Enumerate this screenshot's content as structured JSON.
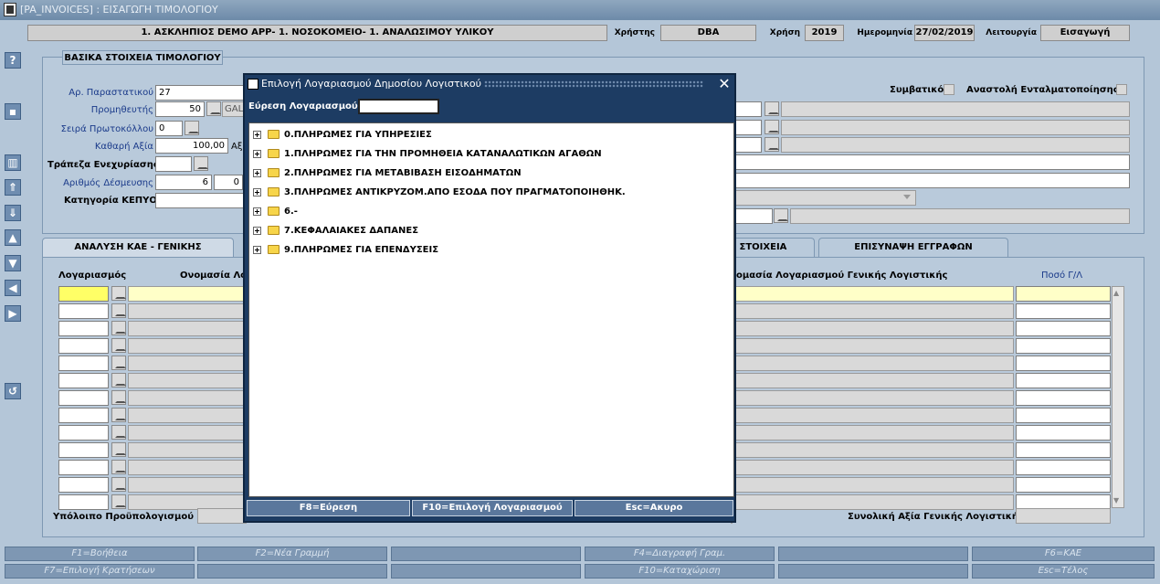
{
  "window": {
    "title": "[PA_INVOICES] : ΕΙΣΑΓΩΓΗ ΤΙΜΟΛΟΓΙΟΥ"
  },
  "header": {
    "org": "1. ΑΣΚΛΗΠΙΟΣ DEMO APP- 1. ΝΟΣΟΚΟΜΕΙΟ- 1. ΑΝΑΛΩΣΙΜΟΥ ΥΛΙΚΟΥ",
    "user_label": "Χρήστης",
    "user": "DBA",
    "year_label": "Χρήση",
    "year": "2019",
    "date_label": "Ημερομηνία",
    "date": "27/02/2019",
    "mode_label": "Λειτουργία",
    "mode": "Εισαγωγή"
  },
  "toolbar": {
    "icons": [
      "help-icon",
      "save-icon",
      "delete-icon",
      "first-record-icon",
      "last-record-icon",
      "prev-record-icon",
      "next-record-icon",
      "back-icon",
      "forward-icon",
      "undo-icon"
    ]
  },
  "basic": {
    "section_title": "ΒΑΣΙΚΑ ΣΤΟΙΧΕΙΑ ΤΙΜΟΛΟΓΙΟΥ",
    "doc_no_label": "Αρ. Παραστατικού",
    "doc_no": "27",
    "supplier_label": "Προμηθευτής",
    "supplier": "50",
    "supplier_name": "GAL",
    "protocol_label": "Σειρά Πρωτοκόλλου",
    "protocol": "0",
    "net_label": "Καθαρή Αξία",
    "net": "100,00",
    "net_suffix": "Αξ",
    "bank_label": "Τράπεζα Ενεχυρίασης",
    "commit_label": "Αριθμός Δέσμευσης",
    "commit_a": "6",
    "commit_b": "0",
    "kepyo_label": "Κατηγορία ΚΕΠΥΟ",
    "contract_label": "Συμβατικό",
    "suspend_label": "Αναστολή Ενταλματοποίησης"
  },
  "tabs": [
    "ΑΝΑΛΥΣΗ ΚΑΕ - ΓΕΝΙΚΗΣ ΛΟΓΙΣΤΙΚΗΣ",
    "ΚΑ ΣΤΟΙΧΕΙΑ",
    "ΕΠΙΣΥΝΑΨΗ ΕΓΓΡΑΦΩΝ"
  ],
  "grid": {
    "col_account": "Λογαριασμός",
    "col_name": "Ονομασία Λο",
    "col_gl_name": "ομασία Λογαριασμού Γενικής Λογιστικής",
    "col_amount": "Ποσό Γ/Λ"
  },
  "footer": {
    "budget_label": "Υπόλοιπο Προϋπολογισμού",
    "total_label": "Συνολική Αξία Γενικής Λογιστικής"
  },
  "fkeys": [
    [
      "F1=Βοήθεια",
      "F2=Νέα Γραμμή",
      "",
      "F4=Διαγραφή Γραμ.",
      "",
      "F6=ΚΑΕ"
    ],
    [
      "F7=Επιλογή Κρατήσεων",
      "",
      "",
      "F10=Καταχώριση",
      "",
      "Esc=Τέλος"
    ]
  ],
  "dialog": {
    "title": "Επιλογή Λογαριασμού Δημοσίου Λογιστικού",
    "search_label": "Εύρεση Λογαριασμού",
    "search_value": "",
    "nodes": [
      "0.ΠΛΗΡΩΜΕΣ ΓΙΑ ΥΠΗΡΕΣΙΕΣ",
      "1.ΠΛΗΡΩΜΕΣ ΓΙΑ ΤΗΝ ΠΡΟΜΗΘΕΙΑ ΚΑΤΑΝΑΛΩΤΙΚΩΝ ΑΓΑΘΩΝ",
      "2.ΠΛΗΡΩΜΕΣ ΓΙΑ ΜΕΤΑΒΙΒΑΣΗ ΕΙΣΟΔΗΜΑΤΩΝ",
      "3.ΠΛΗΡΩΜΕΣ ΑΝΤΙΚΡΥΖΟΜ.ΑΠΟ ΕΣΟΔΑ ΠΟΥ ΠΡΑΓΜΑΤΟΠΟΙΗΘΗΚ.",
      "6.-",
      "7.ΚΕΦΑΛΑΙΑΚΕΣ ΔΑΠΑΝΕΣ",
      "9.ΠΛΗΡΩΜΕΣ ΓΙΑ ΕΠΕΝΔΥΣΕΙΣ"
    ],
    "buttons": {
      "find": "F8=Εύρεση",
      "select": "F10=Επιλογή Λογαριασμού",
      "cancel": "Esc=Ακυρο"
    }
  }
}
